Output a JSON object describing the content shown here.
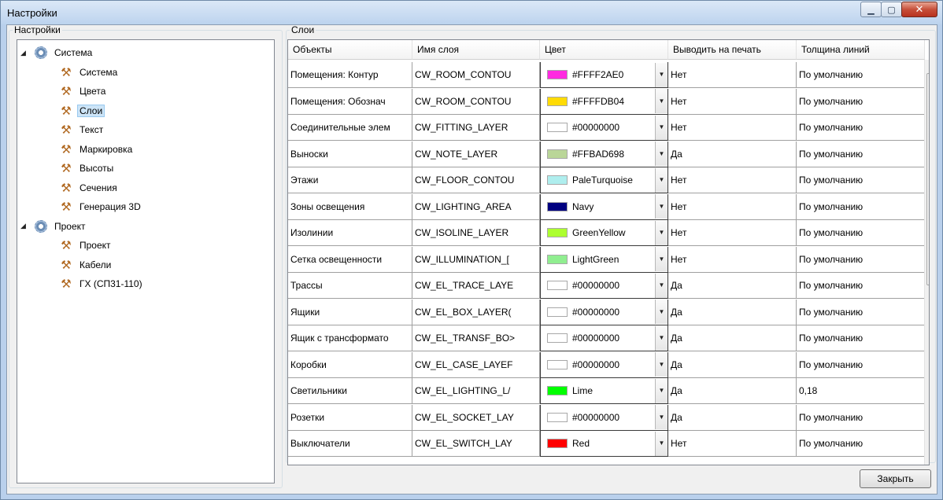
{
  "window": {
    "title": "Настройки"
  },
  "left_panel": {
    "title": "Настройки",
    "tree": [
      {
        "label": "Система",
        "level": 0,
        "icon": "gear-icon",
        "expanded": true,
        "selected": false
      },
      {
        "label": "Система",
        "level": 1,
        "icon": "tools-icon",
        "selected": false
      },
      {
        "label": "Цвета",
        "level": 1,
        "icon": "tools-icon",
        "selected": false
      },
      {
        "label": "Слои",
        "level": 1,
        "icon": "tools-icon",
        "selected": true
      },
      {
        "label": "Текст",
        "level": 1,
        "icon": "tools-icon",
        "selected": false
      },
      {
        "label": "Маркировка",
        "level": 1,
        "icon": "tools-icon",
        "selected": false
      },
      {
        "label": "Высоты",
        "level": 1,
        "icon": "tools-icon",
        "selected": false
      },
      {
        "label": "Сечения",
        "level": 1,
        "icon": "tools-icon",
        "selected": false
      },
      {
        "label": "Генерация 3D",
        "level": 1,
        "icon": "tools-icon",
        "selected": false
      },
      {
        "label": "Проект",
        "level": 0,
        "icon": "gear-icon",
        "expanded": true,
        "selected": false
      },
      {
        "label": "Проект",
        "level": 1,
        "icon": "tools-icon",
        "selected": false
      },
      {
        "label": "Кабели",
        "level": 1,
        "icon": "tools-icon",
        "selected": false
      },
      {
        "label": "ГХ (СП31-110)",
        "level": 1,
        "icon": "tools-icon",
        "selected": false
      }
    ]
  },
  "right_panel": {
    "title": "Слои",
    "columns": [
      "Объекты",
      "Имя слоя",
      "Цвет",
      "Выводить на печать",
      "Толщина линий"
    ],
    "rows": [
      {
        "object": "Помещения: Контур",
        "layer": "CW_ROOM_CONTOU",
        "color_name": "#FFFF2AE0",
        "swatch": "#ff2ae0",
        "print": "Нет",
        "thickness": "По умолчанию"
      },
      {
        "object": "Помещения: Обознач",
        "layer": "CW_ROOM_CONTOU",
        "color_name": "#FFFFDB04",
        "swatch": "#ffdb04",
        "print": "Нет",
        "thickness": "По умолчанию"
      },
      {
        "object": "Соединительные элем",
        "layer": "CW_FITTING_LAYER",
        "color_name": "#00000000",
        "swatch": "#ffffff",
        "print": "Нет",
        "thickness": "По умолчанию"
      },
      {
        "object": "Выноски",
        "layer": "CW_NOTE_LAYER",
        "color_name": "#FFBAD698",
        "swatch": "#bad698",
        "print": "Да",
        "thickness": "По умолчанию"
      },
      {
        "object": "Этажи",
        "layer": "CW_FLOOR_CONTOU",
        "color_name": "PaleTurquoise",
        "swatch": "#afeeee",
        "print": "Нет",
        "thickness": "По умолчанию"
      },
      {
        "object": "Зоны освещения",
        "layer": "CW_LIGHTING_AREA",
        "color_name": "Navy",
        "swatch": "#000080",
        "print": "Нет",
        "thickness": "По умолчанию"
      },
      {
        "object": "Изолинии",
        "layer": "CW_ISOLINE_LAYER",
        "color_name": "GreenYellow",
        "swatch": "#adff2f",
        "print": "Нет",
        "thickness": "По умолчанию"
      },
      {
        "object": "Сетка освещенности",
        "layer": "CW_ILLUMINATION_[",
        "color_name": "LightGreen",
        "swatch": "#90ee90",
        "print": "Нет",
        "thickness": "По умолчанию"
      },
      {
        "object": "Трассы",
        "layer": "CW_EL_TRACE_LAYE",
        "color_name": "#00000000",
        "swatch": "#ffffff",
        "print": "Да",
        "thickness": "По умолчанию"
      },
      {
        "object": "Ящики",
        "layer": "CW_EL_BOX_LAYER(",
        "color_name": "#00000000",
        "swatch": "#ffffff",
        "print": "Да",
        "thickness": "По умолчанию"
      },
      {
        "object": "Ящик с трансформато",
        "layer": "CW_EL_TRANSF_BO>",
        "color_name": "#00000000",
        "swatch": "#ffffff",
        "print": "Да",
        "thickness": "По умолчанию"
      },
      {
        "object": "Коробки",
        "layer": "CW_EL_CASE_LAYEF",
        "color_name": "#00000000",
        "swatch": "#ffffff",
        "print": "Да",
        "thickness": "По умолчанию"
      },
      {
        "object": "Светильники",
        "layer": "CW_EL_LIGHTING_L/",
        "color_name": "Lime",
        "swatch": "#00ff00",
        "print": "Да",
        "thickness": "0,18"
      },
      {
        "object": "Розетки",
        "layer": "CW_EL_SOCKET_LAY",
        "color_name": "#00000000",
        "swatch": "#ffffff",
        "print": "Да",
        "thickness": "По умолчанию"
      },
      {
        "object": "Выключатели",
        "layer": "CW_EL_SWITCH_LAY",
        "color_name": "Red",
        "swatch": "#ff0000",
        "print": "Нет",
        "thickness": "По умолчанию"
      }
    ]
  },
  "buttons": {
    "close": "Закрыть"
  }
}
